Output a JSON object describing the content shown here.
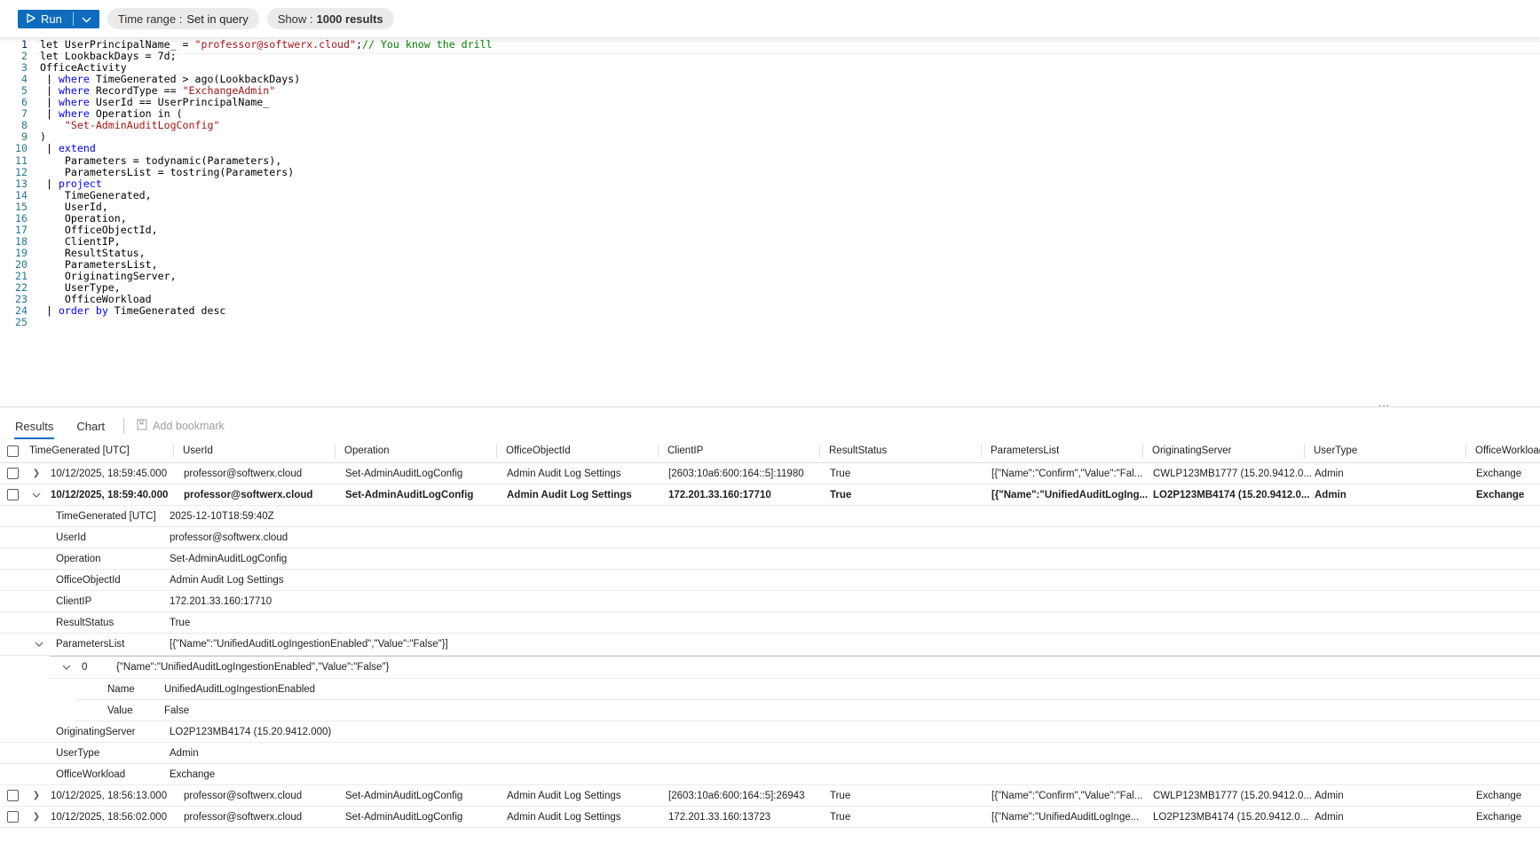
{
  "toolbar": {
    "run_label": "Run",
    "time_range_label": "Time range :",
    "time_range_value": "Set in query",
    "show_label": "Show :",
    "show_value": "1000 results"
  },
  "editor": {
    "lines": [
      {
        "n": "1",
        "tokens": [
          {
            "t": "let UserPrincipalName_ = ",
            "c": ""
          },
          {
            "t": "\"professor@softwerx.cloud\"",
            "c": "str"
          },
          {
            "t": ";",
            "c": ""
          },
          {
            "t": "// You know the drill",
            "c": "cm"
          }
        ]
      },
      {
        "n": "2",
        "tokens": [
          {
            "t": "let LookbackDays = 7d;",
            "c": ""
          }
        ]
      },
      {
        "n": "3",
        "tokens": [
          {
            "t": "OfficeActivity",
            "c": ""
          }
        ]
      },
      {
        "n": "4",
        "tokens": [
          {
            "t": " | ",
            "c": "bar"
          },
          {
            "t": "where",
            "c": "kw"
          },
          {
            "t": " TimeGenerated > ago(LookbackDays)",
            "c": ""
          }
        ]
      },
      {
        "n": "5",
        "tokens": [
          {
            "t": " | ",
            "c": "bar"
          },
          {
            "t": "where",
            "c": "kw"
          },
          {
            "t": " RecordType == ",
            "c": ""
          },
          {
            "t": "\"ExchangeAdmin\"",
            "c": "str"
          }
        ]
      },
      {
        "n": "6",
        "tokens": [
          {
            "t": " | ",
            "c": "bar"
          },
          {
            "t": "where",
            "c": "kw"
          },
          {
            "t": " UserId == UserPrincipalName_",
            "c": ""
          }
        ]
      },
      {
        "n": "7",
        "tokens": [
          {
            "t": " | ",
            "c": "bar"
          },
          {
            "t": "where",
            "c": "kw"
          },
          {
            "t": " Operation in (",
            "c": ""
          }
        ]
      },
      {
        "n": "8",
        "tokens": [
          {
            "t": "    ",
            "c": ""
          },
          {
            "t": "\"Set-AdminAuditLogConfig\"",
            "c": "str"
          }
        ]
      },
      {
        "n": "9",
        "tokens": [
          {
            "t": ")",
            "c": ""
          }
        ]
      },
      {
        "n": "10",
        "tokens": [
          {
            "t": " | ",
            "c": "bar"
          },
          {
            "t": "extend",
            "c": "kw"
          }
        ]
      },
      {
        "n": "11",
        "tokens": [
          {
            "t": "    Parameters = todynamic(Parameters),",
            "c": ""
          }
        ]
      },
      {
        "n": "12",
        "tokens": [
          {
            "t": "    ParametersList = tostring(Parameters)",
            "c": ""
          }
        ]
      },
      {
        "n": "13",
        "tokens": [
          {
            "t": " | ",
            "c": "bar"
          },
          {
            "t": "project",
            "c": "kw"
          }
        ]
      },
      {
        "n": "14",
        "tokens": [
          {
            "t": "    TimeGenerated,",
            "c": ""
          }
        ]
      },
      {
        "n": "15",
        "tokens": [
          {
            "t": "    UserId,",
            "c": ""
          }
        ]
      },
      {
        "n": "16",
        "tokens": [
          {
            "t": "    Operation,",
            "c": ""
          }
        ]
      },
      {
        "n": "17",
        "tokens": [
          {
            "t": "    OfficeObjectId,",
            "c": ""
          }
        ]
      },
      {
        "n": "18",
        "tokens": [
          {
            "t": "    ClientIP,",
            "c": ""
          }
        ]
      },
      {
        "n": "19",
        "tokens": [
          {
            "t": "    ResultStatus,",
            "c": ""
          }
        ]
      },
      {
        "n": "20",
        "tokens": [
          {
            "t": "    ParametersList,",
            "c": ""
          }
        ]
      },
      {
        "n": "21",
        "tokens": [
          {
            "t": "    OriginatingServer,",
            "c": ""
          }
        ]
      },
      {
        "n": "22",
        "tokens": [
          {
            "t": "    UserType,",
            "c": ""
          }
        ]
      },
      {
        "n": "23",
        "tokens": [
          {
            "t": "    OfficeWorkload",
            "c": ""
          }
        ]
      },
      {
        "n": "24",
        "tokens": [
          {
            "t": " | ",
            "c": "bar"
          },
          {
            "t": "order by",
            "c": "kw"
          },
          {
            "t": " TimeGenerated desc",
            "c": ""
          }
        ]
      },
      {
        "n": "25",
        "tokens": []
      }
    ]
  },
  "splitter_dots": "...",
  "tabs": {
    "results": "Results",
    "chart": "Chart",
    "bookmark": "Add bookmark"
  },
  "grid": {
    "columns": [
      "TimeGenerated [UTC]",
      "UserId",
      "Operation",
      "OfficeObjectId",
      "ClientIP",
      "ResultStatus",
      "ParametersList",
      "OriginatingServer",
      "UserType",
      "OfficeWorkload"
    ],
    "rows": [
      [
        "10/12/2025, 18:59:45.000",
        "professor@softwerx.cloud",
        "Set-AdminAuditLogConfig",
        "Admin Audit Log Settings",
        "[2603:10a6:600:164::5]:11980",
        "True",
        "[{\"Name\":\"Confirm\",\"Value\":\"Fal...",
        "CWLP123MB1777 (15.20.9412.0...",
        "Admin",
        "Exchange"
      ],
      [
        "10/12/2025, 18:59:40.000",
        "professor@softwerx.cloud",
        "Set-AdminAuditLogConfig",
        "Admin Audit Log Settings",
        "172.201.33.160:17710",
        "True",
        "[{\"Name\":\"UnifiedAuditLogIng...",
        "LO2P123MB4174 (15.20.9412.0...",
        "Admin",
        "Exchange"
      ],
      [
        "10/12/2025, 18:56:13.000",
        "professor@softwerx.cloud",
        "Set-AdminAuditLogConfig",
        "Admin Audit Log Settings",
        "[2603:10a6:600:164::5]:26943",
        "True",
        "[{\"Name\":\"Confirm\",\"Value\":\"Fal...",
        "CWLP123MB1777 (15.20.9412.0...",
        "Admin",
        "Exchange"
      ],
      [
        "10/12/2025, 18:56:02.000",
        "professor@softwerx.cloud",
        "Set-AdminAuditLogConfig",
        "Admin Audit Log Settings",
        "172.201.33.160:13723",
        "True",
        "[{\"Name\":\"UnifiedAuditLogInge...",
        "LO2P123MB4174 (15.20.9412.0...",
        "Admin",
        "Exchange"
      ]
    ],
    "detail": {
      "top": [
        {
          "k": "TimeGenerated [UTC]",
          "v": "2025-12-10T18:59:40Z"
        },
        {
          "k": "UserId",
          "v": "professor@softwerx.cloud"
        },
        {
          "k": "Operation",
          "v": "Set-AdminAuditLogConfig"
        },
        {
          "k": "OfficeObjectId",
          "v": "Admin Audit Log Settings"
        },
        {
          "k": "ClientIP",
          "v": "172.201.33.160:17710"
        },
        {
          "k": "ResultStatus",
          "v": "True"
        }
      ],
      "params_key": "ParametersList",
      "params_value": "[{\"Name\":\"UnifiedAuditLogIngestionEnabled\",\"Value\":\"False\"}]",
      "item_index": "0",
      "item_value": "{\"Name\":\"UnifiedAuditLogIngestionEnabled\",\"Value\":\"False\"}",
      "item_fields": [
        {
          "k": "Name",
          "v": "UnifiedAuditLogIngestionEnabled"
        },
        {
          "k": "Value",
          "v": "False"
        }
      ],
      "bottom": [
        {
          "k": "OriginatingServer",
          "v": "LO2P123MB4174 (15.20.9412.000)"
        },
        {
          "k": "UserType",
          "v": "Admin"
        },
        {
          "k": "OfficeWorkload",
          "v": "Exchange"
        }
      ]
    }
  }
}
